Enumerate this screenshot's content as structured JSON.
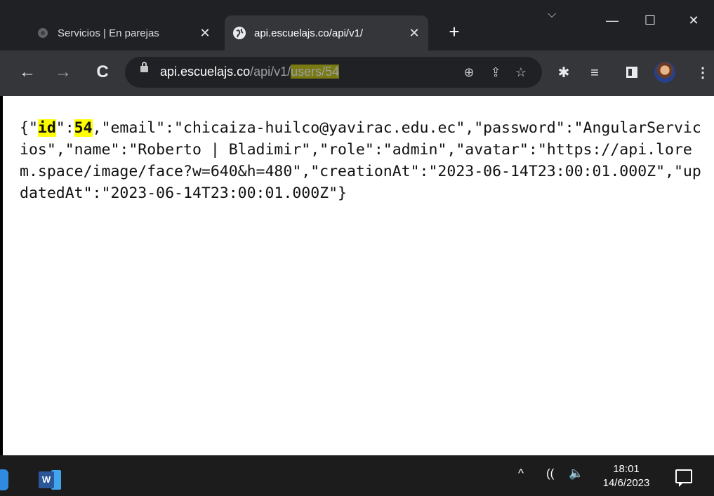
{
  "tabs": [
    {
      "title": "Servicios | En parejas",
      "close": "✕",
      "active": false
    },
    {
      "title": "api.escuelajs.co/api/v1/",
      "close": "✕",
      "active": true
    }
  ],
  "new_tab": "+",
  "window_controls": {
    "search_tabs": "⌵",
    "minimize": "—",
    "maximize": "☐",
    "close": "✕"
  },
  "toolbar": {
    "back": "←",
    "forward": "→",
    "reload": "C",
    "url_host": "api.escuelajs.co",
    "url_path_dim": "/api/v1/",
    "url_path_highlight": "users/54",
    "zoom": "⊕",
    "share": "⇪",
    "bookmark": "☆",
    "extensions": "✱",
    "reading_list": "≡"
  },
  "content": {
    "json_open": "{\"",
    "id_key": "id",
    "after_key": "\":",
    "id_value": "54",
    "json_rest": ",\"email\":\"chicaiza-huilco@yavirac.edu.ec\",\"password\":\"AngularServicios\",\"name\":\"Roberto | Bladimir\",\"role\":\"admin\",\"avatar\":\"https://api.lorem.space/image/face?w=640&h=480\",\"creationAt\":\"2023-06-14T23:00:01.000Z\",\"updatedAt\":\"2023-06-14T23:00:01.000Z\"}"
  },
  "taskbar": {
    "word_letter": "W",
    "tray_chevron": "^",
    "wifi": "((",
    "volume": "🔈",
    "time": "18:01",
    "date": "14/6/2023"
  },
  "colors": {
    "tabstrip": "#202124",
    "toolbar": "#35363a",
    "highlight": "#ffff00",
    "taskbar": "#1c1c1c"
  },
  "icons": [
    "chrome-tab-icon",
    "globe-icon",
    "lock-icon",
    "puzzle-icon",
    "side-panel-icon",
    "profile-avatar",
    "word-icon",
    "notification-icon"
  ]
}
